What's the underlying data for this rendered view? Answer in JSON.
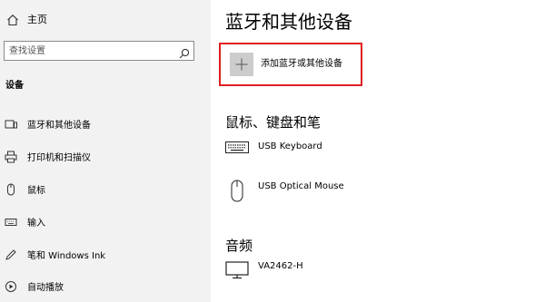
{
  "sidebar": {
    "home": {
      "label": "主页",
      "icon": "home-icon"
    },
    "search": {
      "placeholder": "查找设置",
      "icon": "search-icon"
    },
    "section_title": "设备",
    "items": [
      {
        "label": "蓝牙和其他设备",
        "icon": "bluetooth-devices-icon"
      },
      {
        "label": "打印机和扫描仪",
        "icon": "printer-icon"
      },
      {
        "label": "鼠标",
        "icon": "mouse-icon"
      },
      {
        "label": "输入",
        "icon": "keyboard-icon"
      },
      {
        "label": "笔和 Windows Ink",
        "icon": "pen-icon"
      },
      {
        "label": "自动播放",
        "icon": "autoplay-icon"
      }
    ]
  },
  "main": {
    "title": "蓝牙和其他设备",
    "add_device": {
      "label": "添加蓝牙或其他设备",
      "icon": "plus-icon"
    },
    "sections": [
      {
        "title": "鼠标、键盘和笔",
        "devices": [
          {
            "name": "USB Keyboard",
            "icon": "keyboard-icon"
          },
          {
            "name": "USB Optical Mouse",
            "icon": "mouse-icon"
          }
        ]
      },
      {
        "title": "音频",
        "devices": [
          {
            "name": "VA2462-H",
            "icon": "monitor-icon"
          }
        ]
      }
    ]
  },
  "colors": {
    "sidebar_bg": "#f2f2f2",
    "highlight_border": "#e02020",
    "add_button_bg": "#cccccc"
  }
}
